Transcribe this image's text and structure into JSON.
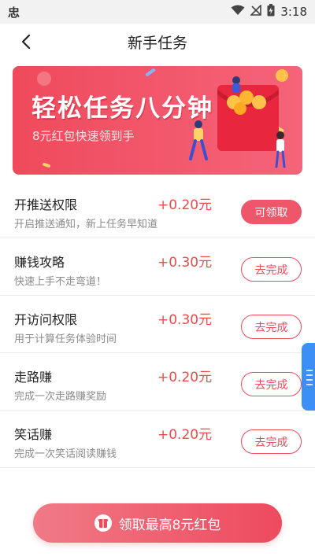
{
  "status_bar": {
    "left_glyph": "忠",
    "time": "3:18",
    "icons": [
      "wifi-icon",
      "signal-off-icon",
      "battery-charging-icon"
    ]
  },
  "nav": {
    "title": "新手任务",
    "back_icon": "chevron-left-icon"
  },
  "banner": {
    "title": "轻松任务八分钟",
    "subtitle": "8元红包快速领到手"
  },
  "tasks": [
    {
      "title": "开推送权限",
      "desc": "开启推送通知，新上任务早知道",
      "reward": "+0.20元",
      "button": "可领取",
      "state": "claimable"
    },
    {
      "title": "赚钱攻略",
      "desc": "快速上手不走弯道！",
      "reward": "+0.30元",
      "button": "去完成",
      "state": "todo"
    },
    {
      "title": "开访问权限",
      "desc": "用于计算任务体验时间",
      "reward": "+0.30元",
      "button": "去完成",
      "state": "todo"
    },
    {
      "title": "走路赚",
      "desc": "完成一次走路赚奖励",
      "reward": "+0.20元",
      "button": "去完成",
      "state": "todo"
    },
    {
      "title": "笑话赚",
      "desc": "完成一次笑话阅读赚钱",
      "reward": "+0.20元",
      "button": "去完成",
      "state": "todo"
    }
  ],
  "bottom_button": {
    "label": "领取最高8元红包",
    "icon": "gift-bag-icon"
  },
  "colors": {
    "accent": "#ef4a5c",
    "reward": "#ef4a4a",
    "side_tab": "#3b8ff5"
  }
}
